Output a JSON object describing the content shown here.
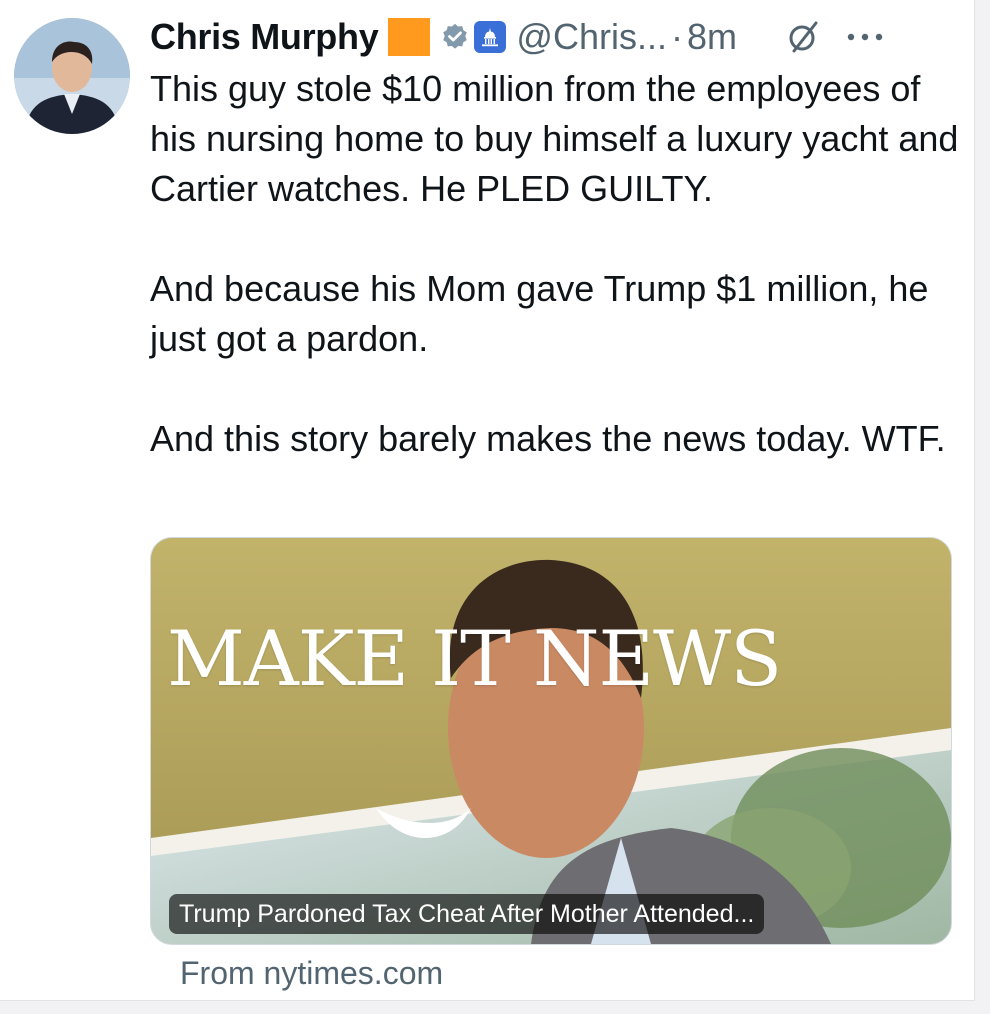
{
  "author": {
    "display_name": "Chris Murphy",
    "handle": "@Chris...",
    "separator": "·",
    "time": "8m"
  },
  "icons": {
    "avatar": "profile-photo-icon",
    "badge_square": "orange-square-emoji-icon",
    "verified": "verified-badge-icon",
    "government": "capitol-building-icon",
    "grok": "grok-slash-icon",
    "more": "more-options-icon"
  },
  "colors": {
    "badge_square": "#ff9a1f",
    "verified": "#829aab",
    "government": "#3b6fd8",
    "secondary_text": "#536471"
  },
  "tweet": {
    "paragraphs": [
      "This guy stole $10 million from the employees of his nursing home to buy himself a luxury yacht and Cartier watches. He PLED GUILTY.",
      "And because his Mom gave Trump $1 million, he just got a pardon.",
      "And this story barely makes the news today. WTF."
    ]
  },
  "card": {
    "image_headline": "MAKE IT NEWS",
    "title": "Trump Pardoned Tax Cheat After Mother Attended...",
    "source": "From nytimes.com"
  }
}
